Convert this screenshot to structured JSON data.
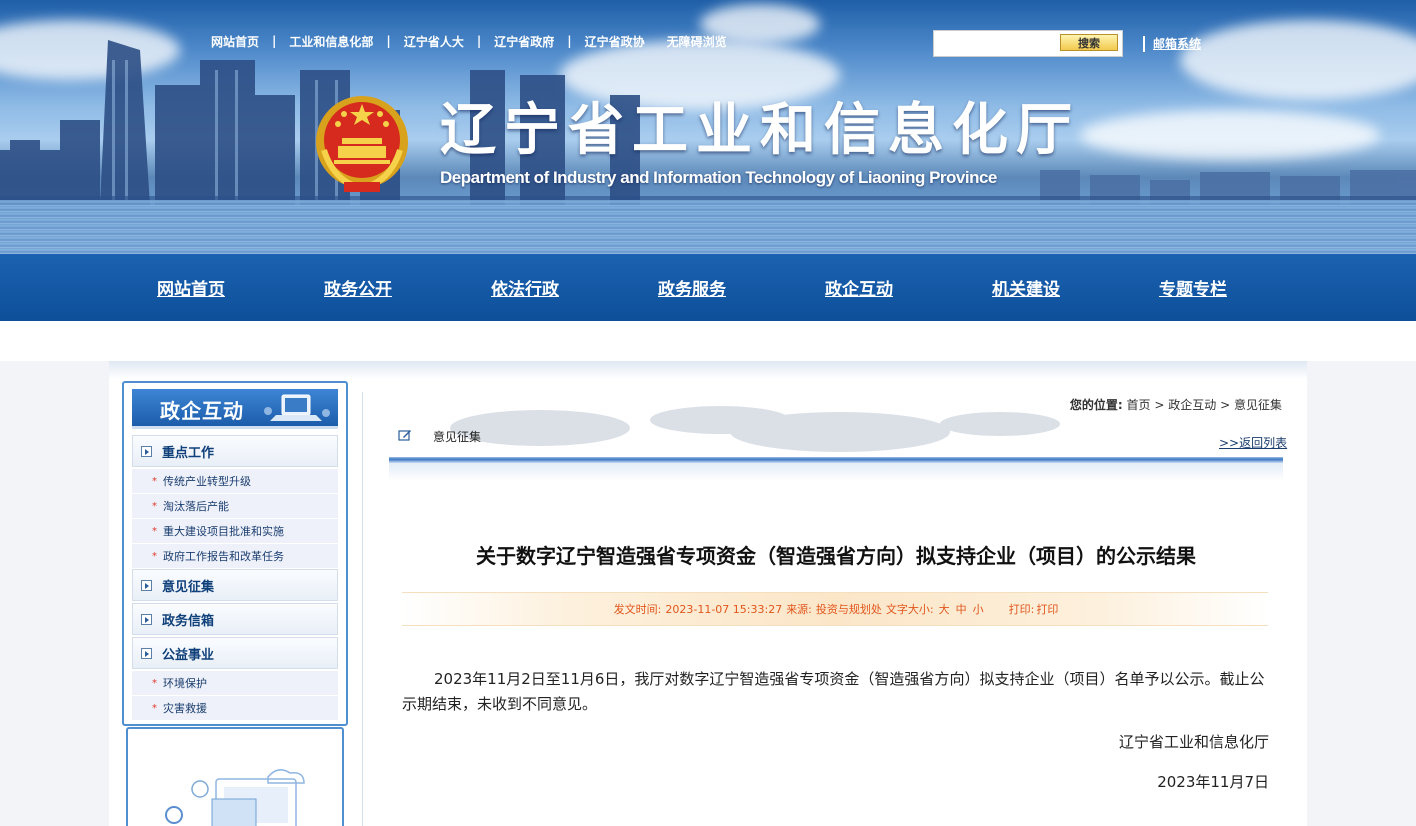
{
  "top_links": [
    "网站首页",
    "工业和信息化部",
    "辽宁省人大",
    "辽宁省政府",
    "辽宁省政协",
    "无障碍浏览"
  ],
  "search": {
    "button_label": "搜索",
    "value": ""
  },
  "mail_link": "邮箱系统",
  "site": {
    "title": "辽宁省工业和信息化厅",
    "subtitle": "Department of Industry and Information Technology of Liaoning Province"
  },
  "nav": [
    "网站首页",
    "政务公开",
    "依法行政",
    "政务服务",
    "政企互动",
    "机关建设",
    "专题专栏"
  ],
  "sidebar": {
    "heading": "政企互动",
    "categories": [
      {
        "label": "重点工作",
        "subs": [
          "传统产业转型升级",
          "淘汰落后产能",
          "重大建设项目批准和实施",
          "政府工作报告和改革任务"
        ]
      },
      {
        "label": "意见征集",
        "subs": []
      },
      {
        "label": "政务信箱",
        "subs": []
      },
      {
        "label": "公益事业",
        "subs": [
          "环境保护",
          "灾害救援"
        ]
      }
    ]
  },
  "breadcrumb": {
    "prefix": "您的位置:",
    "items": [
      "首页",
      "政企互动",
      "意见征集"
    ],
    "sep": ">"
  },
  "section": {
    "title": "意见征集",
    "back_link": ">>返回列表"
  },
  "article": {
    "title": "关于数字辽宁智造强省专项资金（智造强省方向）拟支持企业（项目）的公示结果",
    "meta": {
      "time_label": "发文时间:",
      "time": "2023-11-07 15:33:27",
      "source_label": "来源:",
      "source": "投资与规划处",
      "font_label": "文字大小:",
      "font_large": "大",
      "font_medium": "中",
      "font_small": "小",
      "print_label": "打印:",
      "print_link": "打印"
    },
    "body": "2023年11月2日至11月6日，我厅对数字辽宁智造强省专项资金（智造强省方向）拟支持企业（项目）名单予以公示。截止公示期结束，未收到不同意见。",
    "signature": "辽宁省工业和信息化厅",
    "date": "2023年11月7日"
  },
  "colors": {
    "nav_bg": "#0e4f99",
    "accent_orange": "#e0561c",
    "link_blue": "#1a3d6e"
  }
}
